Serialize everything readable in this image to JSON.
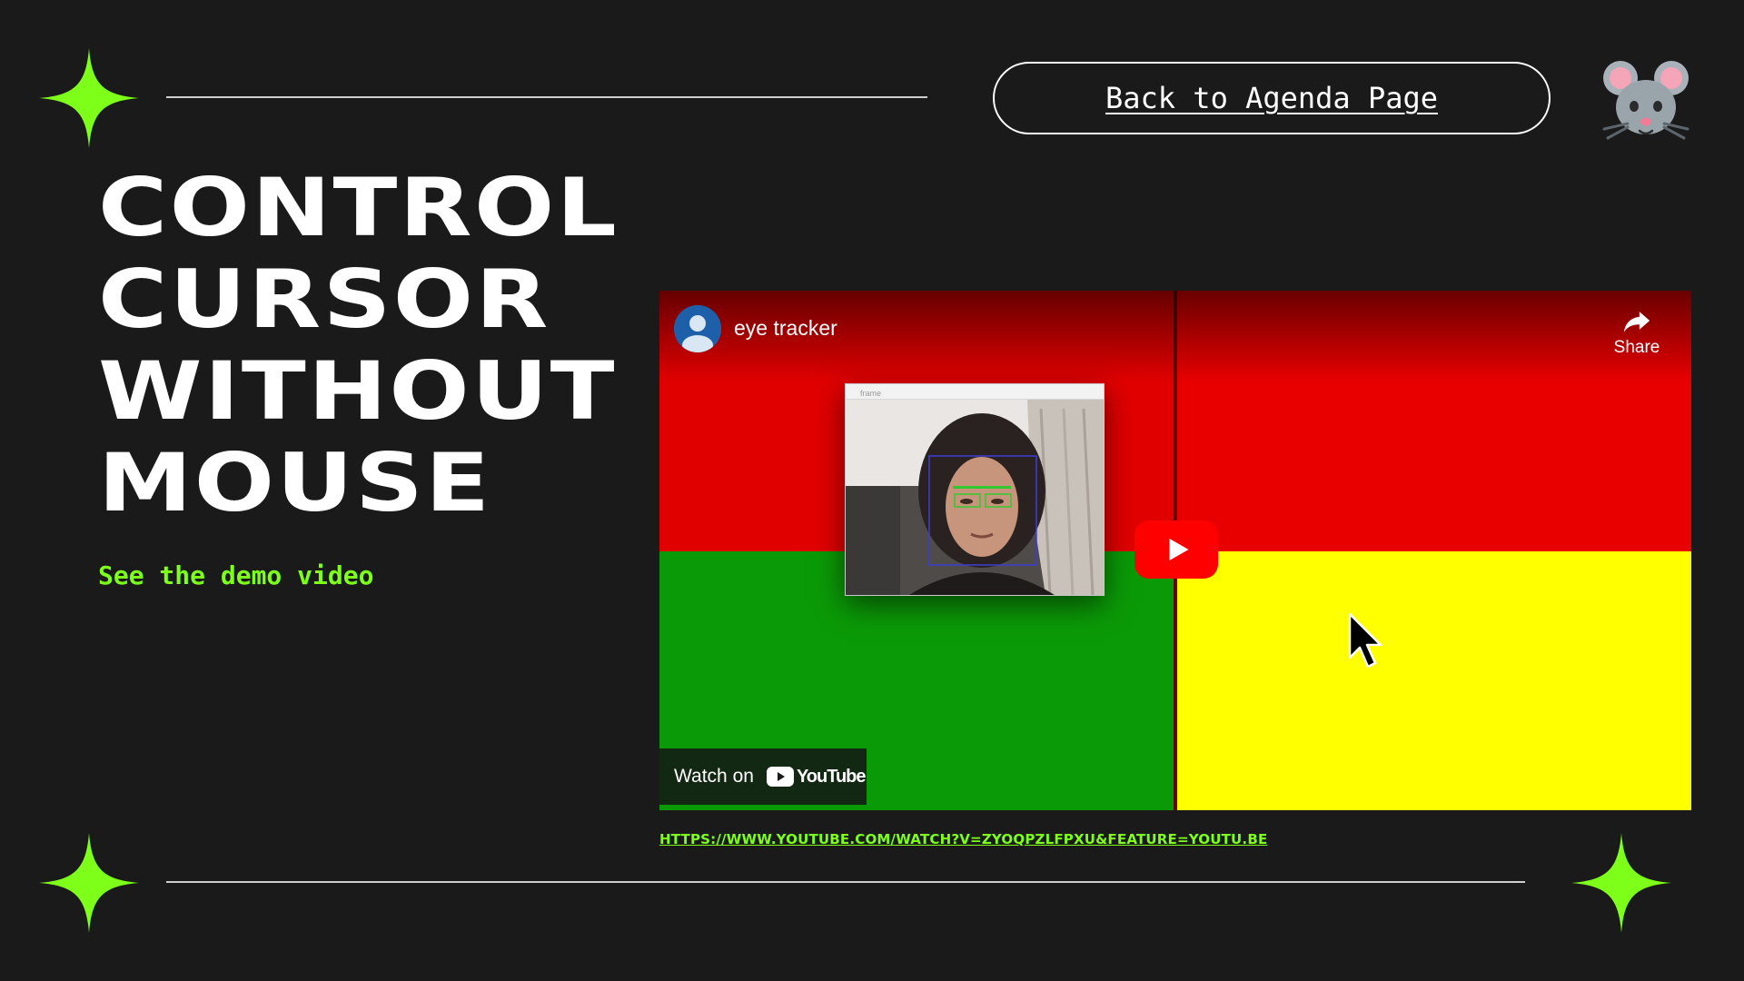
{
  "header": {
    "back_button_label": "Back to Agenda Page"
  },
  "title": {
    "lines": [
      "CONTROL",
      "CURSOR",
      "WITHOUT",
      "MOUSE"
    ]
  },
  "subtitle": "See the demo video",
  "video": {
    "channel_title": "eye tracker",
    "share_label": "Share",
    "webcam_window_title": "frame",
    "watch_on_label": "Watch on",
    "youtube_logo_text": "YouTube",
    "colors": {
      "top_left": "#e10000",
      "top_right": "#e80000",
      "bottom_left": "#0b9a07",
      "bottom_right": "#ffff00",
      "play_button": "#ff0000"
    }
  },
  "link": {
    "url_text": "HTTPS://WWW.YOUTUBE.COM/WATCH?V=ZYOQPZLFPXU&FEATURE=YOUTU.BE"
  },
  "icons": {
    "decorative_star": "sparkle-star-icon",
    "mascot": "mouse-face-icon",
    "share": "share-arrow-icon",
    "play": "play-icon",
    "cursor": "mouse-pointer-icon"
  },
  "theme": {
    "background": "#1a1a1b",
    "accent": "#7dff1a",
    "text": "#ffffff"
  }
}
